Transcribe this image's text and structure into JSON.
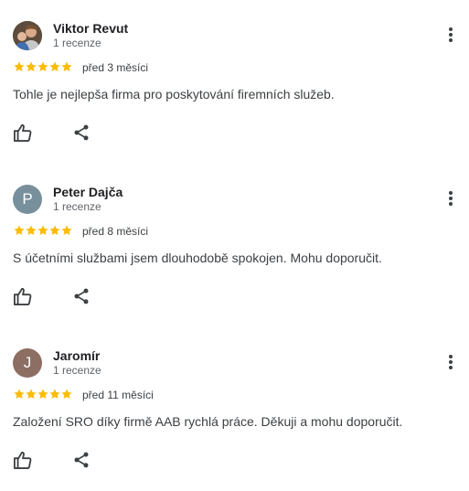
{
  "reviews": [
    {
      "author": "Viktor Revut",
      "review_count": "1 recenze",
      "rating": 5,
      "date": "před 3 měsíci",
      "text": "Tohle je nejlepša firma pro poskytování firemních služeb.",
      "avatar_letter": "",
      "avatar_type": "photo",
      "avatar_color": "#6b5a4a"
    },
    {
      "author": "Peter Dajča",
      "review_count": "1 recenze",
      "rating": 5,
      "date": "před 8 měsíci",
      "text": "S účetními službami jsem dlouhodobě spokojen. Mohu doporučit.",
      "avatar_letter": "P",
      "avatar_type": "letter",
      "avatar_color": "#78909c"
    },
    {
      "author": "Jaromír",
      "review_count": "1 recenze",
      "rating": 5,
      "date": "před 11 měsíci",
      "text": "Založení SRO díky firmě AAB rychlá práce. Děkuji a mohu doporučit.",
      "avatar_letter": "J",
      "avatar_type": "letter",
      "avatar_color": "#8d6e63"
    }
  ],
  "icons": {
    "star": "star-icon",
    "like": "thumb-up-icon",
    "share": "share-icon",
    "more": "more-vert-icon"
  },
  "colors": {
    "star": "#fbbc04"
  }
}
